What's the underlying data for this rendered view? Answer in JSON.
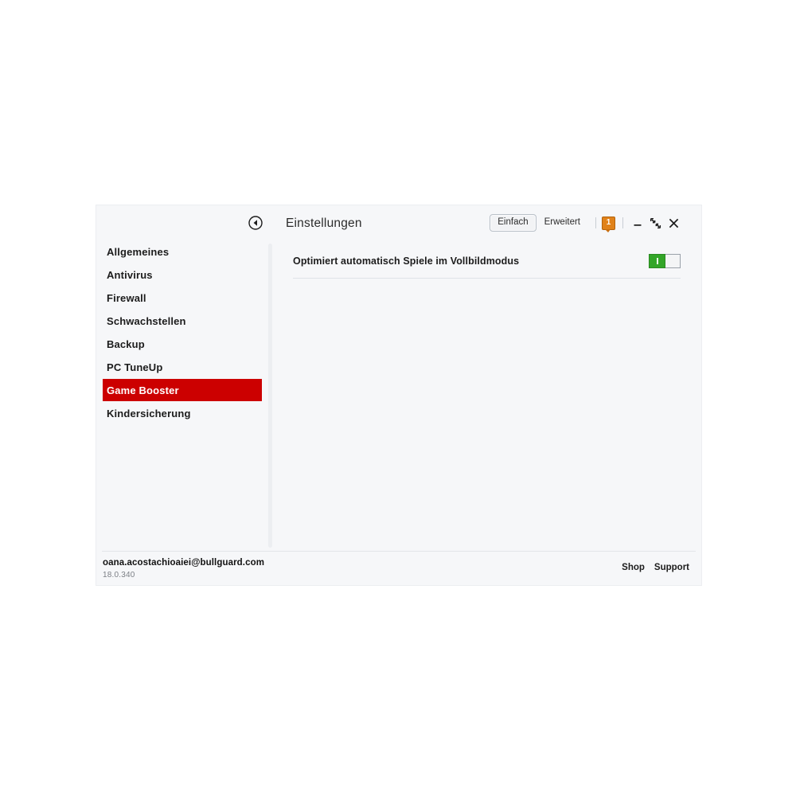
{
  "window": {
    "title": "Einstellungen",
    "back_icon": "back-arrow-circle-icon"
  },
  "titlebar": {
    "modes": [
      {
        "label": "Einfach",
        "selected": true
      },
      {
        "label": "Erweitert",
        "selected": false
      }
    ],
    "notification_count": "1",
    "controls": {
      "minimize": "minimize-icon",
      "restore": "restore-icon",
      "close": "close-icon"
    }
  },
  "sidebar": {
    "items": [
      {
        "label": "Allgemeines",
        "active": false
      },
      {
        "label": "Antivirus",
        "active": false
      },
      {
        "label": "Firewall",
        "active": false
      },
      {
        "label": "Schwachstellen",
        "active": false
      },
      {
        "label": "Backup",
        "active": false
      },
      {
        "label": "PC TuneUp",
        "active": false
      },
      {
        "label": "Game Booster",
        "active": true
      },
      {
        "label": "Kindersicherung",
        "active": false
      }
    ]
  },
  "content": {
    "setting": {
      "label": "Optimiert automatisch Spiele im Vollbildmodus",
      "toggle_state": "on"
    }
  },
  "footer": {
    "email": "oana.acostachioaiei@bullguard.com",
    "version": "18.0.340",
    "links": [
      {
        "label": "Shop"
      },
      {
        "label": "Support"
      }
    ]
  },
  "colors": {
    "accent_red": "#cc0000",
    "badge_orange": "#e0821a",
    "toggle_green": "#33a528",
    "window_bg": "#f6f7f9"
  }
}
